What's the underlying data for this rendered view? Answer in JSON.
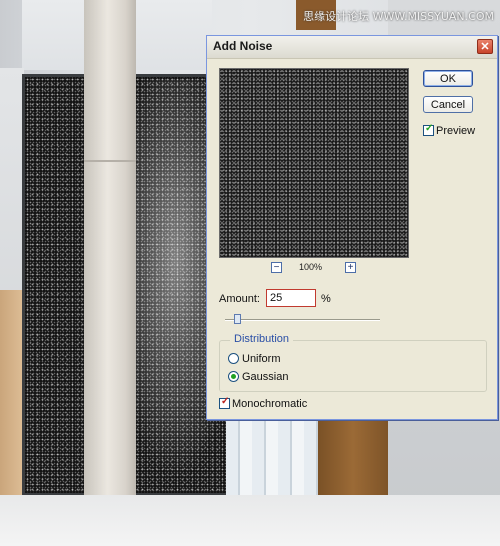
{
  "watermark": "思缘设计论坛 WWW.MISSYUAN.COM",
  "dialog": {
    "title": "Add Noise",
    "close_glyph": "✕",
    "ok_label": "OK",
    "cancel_label": "Cancel",
    "preview_label": "Preview",
    "preview_checked": true,
    "zoom_out_glyph": "−",
    "zoom_in_glyph": "+",
    "zoom_level": "100%",
    "amount_label": "Amount:",
    "amount_value": "25",
    "amount_unit": "%",
    "amount_slider_fraction": 0.06,
    "distribution": {
      "legend": "Distribution",
      "options": [
        "Uniform",
        "Gaussian"
      ],
      "selected": "Gaussian"
    },
    "monochromatic_label": "Monochromatic",
    "monochromatic_checked": true
  },
  "colors": {
    "accent_check": "#21a121",
    "mono_check": "#b8201b",
    "input_border": "#c13a2f"
  }
}
